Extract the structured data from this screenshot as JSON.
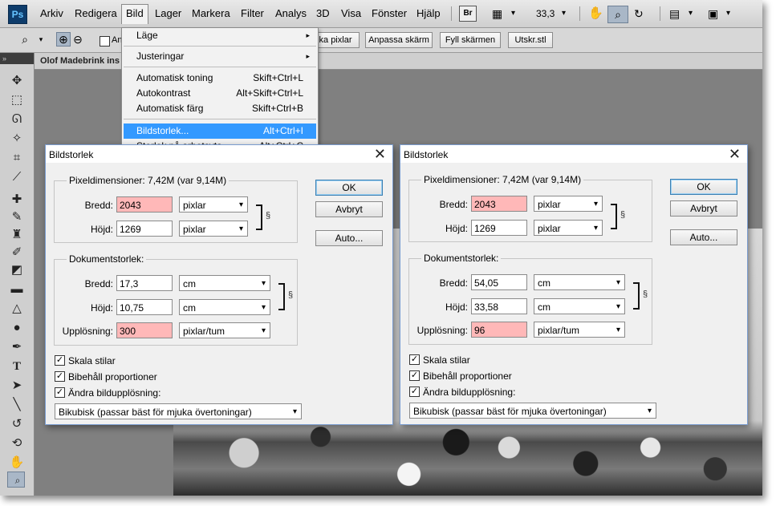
{
  "app": {
    "logo": "Ps",
    "zoom": "33,3",
    "br_label": "Br"
  },
  "menubar": [
    "Arkiv",
    "Redigera",
    "Bild",
    "Lager",
    "Markera",
    "Filter",
    "Analys",
    "3D",
    "Visa",
    "Fönster",
    "Hjälp"
  ],
  "optionsbar": {
    "partial_label": "An",
    "buttons": [
      "ka pixlar",
      "Anpassa skärm",
      "Fyll skärmen",
      "Utskr.stl"
    ]
  },
  "document": {
    "tab_title": "Olof Madebrink ins"
  },
  "bild_menu": {
    "items": [
      {
        "label": "Läge",
        "shortcut": "",
        "submenu": true
      },
      {
        "label": "Justeringar",
        "shortcut": "",
        "submenu": true
      },
      {
        "label": "Automatisk toning",
        "shortcut": "Skift+Ctrl+L"
      },
      {
        "label": "Autokontrast",
        "shortcut": "Alt+Skift+Ctrl+L"
      },
      {
        "label": "Automatisk färg",
        "shortcut": "Skift+Ctrl+B"
      },
      {
        "label": "Bildstorlek...",
        "shortcut": "Alt+Ctrl+I",
        "highlighted": true
      },
      {
        "label": "Storlek på arbetsyta...",
        "shortcut": "Alt+Ctrl+C"
      }
    ]
  },
  "dialog_common": {
    "title": "Bildstorlek",
    "pixel_group": "Pixeldimensioner: 7,42M (var 9,14M)",
    "width_label": "Bredd:",
    "height_label": "Höjd:",
    "doc_group": "Dokumentstorlek:",
    "resolution_label": "Upplösning:",
    "ok": "OK",
    "cancel": "Avbryt",
    "auto": "Auto...",
    "scale_styles": "Skala stilar",
    "keep_proportions": "Bibehåll proportioner",
    "resample": "Ändra bildupplösning:",
    "method": "Bikubisk (passar bäst för mjuka övertoningar)"
  },
  "dialog_left": {
    "pixel_width": "2043",
    "pixel_width_unit": "pixlar",
    "pixel_height": "1269",
    "pixel_height_unit": "pixlar",
    "doc_width": "17,3",
    "doc_width_unit": "cm",
    "doc_height": "10,75",
    "doc_height_unit": "cm",
    "resolution": "300",
    "resolution_unit": "pixlar/tum"
  },
  "dialog_right": {
    "pixel_width": "2043",
    "pixel_width_unit": "pixlar",
    "pixel_height": "1269",
    "pixel_height_unit": "pixlar",
    "doc_width": "54,05",
    "doc_width_unit": "cm",
    "doc_height": "33,58",
    "doc_height_unit": "cm",
    "resolution": "96",
    "resolution_unit": "pixlar/tum"
  },
  "checks": {
    "scale_styles": "✓",
    "keep_proportions": "✓",
    "resample": "✓"
  },
  "glyphs": {
    "chevron": "▾",
    "arrow": "▸",
    "close": "✕",
    "chain": "§"
  },
  "colors": {
    "highlight": "#3399ff",
    "error_field": "#ffb8b8"
  }
}
